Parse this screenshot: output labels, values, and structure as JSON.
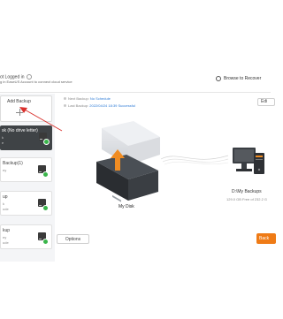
{
  "header": {
    "status_text": "ot Logged in",
    "subtitle": "g in EaseUS Account to connect cloud service",
    "browse_label": "Browse to Recover"
  },
  "sidebar": {
    "add_backup_label": "Add Backup",
    "tasks": [
      {
        "title": "sk (No drive letter)",
        "line2": "k",
        "line3": "e"
      },
      {
        "title": "Backup(1)",
        "line2": "ey",
        "line3": ""
      },
      {
        "title": "up",
        "line2": "k",
        "line3": "ude"
      },
      {
        "title": "kup",
        "line2": "ey",
        "line3": "ude"
      }
    ]
  },
  "info": {
    "next_backup_label": "Next Backup:",
    "next_backup_value": "No Schedule",
    "last_backup_label": "Last Backup:",
    "last_backup_value": "2022/04/24 18:39 Successful"
  },
  "source": {
    "label": "My Disk"
  },
  "destination": {
    "label": "D:\\My Backups",
    "info": "129.0 GB Free of 232.2 G"
  },
  "buttons": {
    "options": "Options",
    "edit": "Edi",
    "backup_now": "Back"
  },
  "colors": {
    "accent_orange": "#ef7b16",
    "link_blue": "#2e7bd6",
    "selected_task": "#3f4346",
    "arrow_red": "#d9302c",
    "success_green": "#39b54a"
  }
}
